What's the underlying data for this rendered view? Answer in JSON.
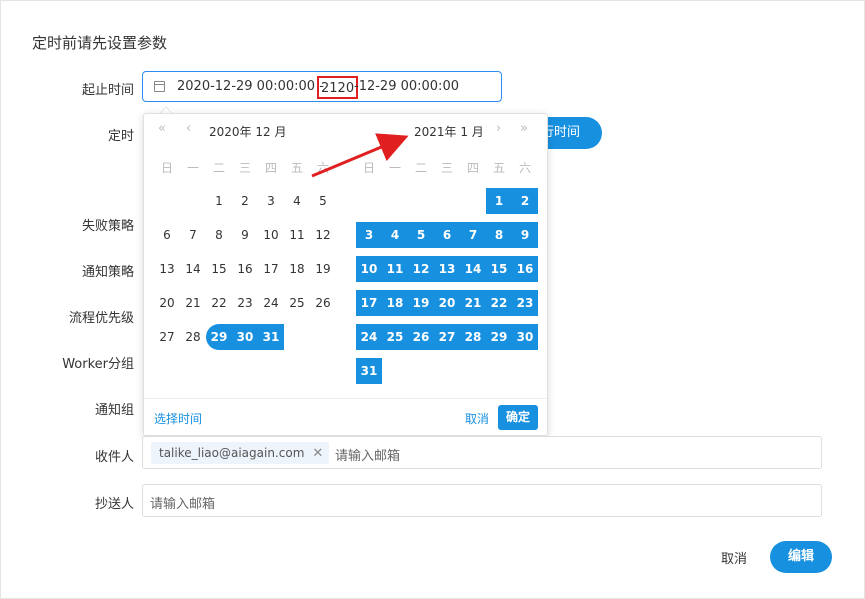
{
  "dialog": {
    "title": "定时前请先设置参数"
  },
  "form": {
    "labels": {
      "range": "起止时间",
      "cron": "定时",
      "failure": "失败策略",
      "notify": "通知策略",
      "priority": "流程优先级",
      "worker": "Worker分组",
      "notify_group": "通知组",
      "receivers": "收件人",
      "cc": "抄送人"
    },
    "range": {
      "part1": "2020-12-29 00:00:00 - ",
      "highlight": "2120",
      "part3": "-12-29 00:00:00"
    },
    "run_button_partial": "行时间",
    "receivers": {
      "tag": "talike_liao@aiagain.com",
      "placeholder": "请输入邮箱"
    },
    "cc": {
      "placeholder": "请输入邮箱"
    }
  },
  "picker": {
    "left_title": "2020年 12 月",
    "right_title": "2021年 1 月",
    "weekdays": [
      "日",
      "一",
      "二",
      "三",
      "四",
      "五",
      "六"
    ],
    "left_days": [
      1,
      2,
      3,
      4,
      5,
      6,
      7,
      8,
      9,
      10,
      11,
      12,
      13,
      14,
      15,
      16,
      17,
      18,
      19,
      20,
      21,
      22,
      23,
      24,
      25,
      26,
      27,
      28,
      29,
      30,
      31
    ],
    "left_first_col": 2,
    "left_selected_from": 29,
    "right_days": [
      1,
      2,
      3,
      4,
      5,
      6,
      7,
      8,
      9,
      10,
      11,
      12,
      13,
      14,
      15,
      16,
      17,
      18,
      19,
      20,
      21,
      22,
      23,
      24,
      25,
      26,
      27,
      28,
      29,
      30,
      31
    ],
    "right_first_col": 5,
    "footer": {
      "choose_time": "选择时间",
      "cancel": "取消",
      "ok": "确定"
    }
  },
  "footer": {
    "cancel": "取消",
    "edit": "编辑"
  },
  "icons": {
    "prev_year": "«",
    "prev_month": "‹",
    "next_month": "›",
    "next_year": "»",
    "close": "✕"
  },
  "colors": {
    "primary": "#1890e0",
    "annotation": "#e02020"
  }
}
